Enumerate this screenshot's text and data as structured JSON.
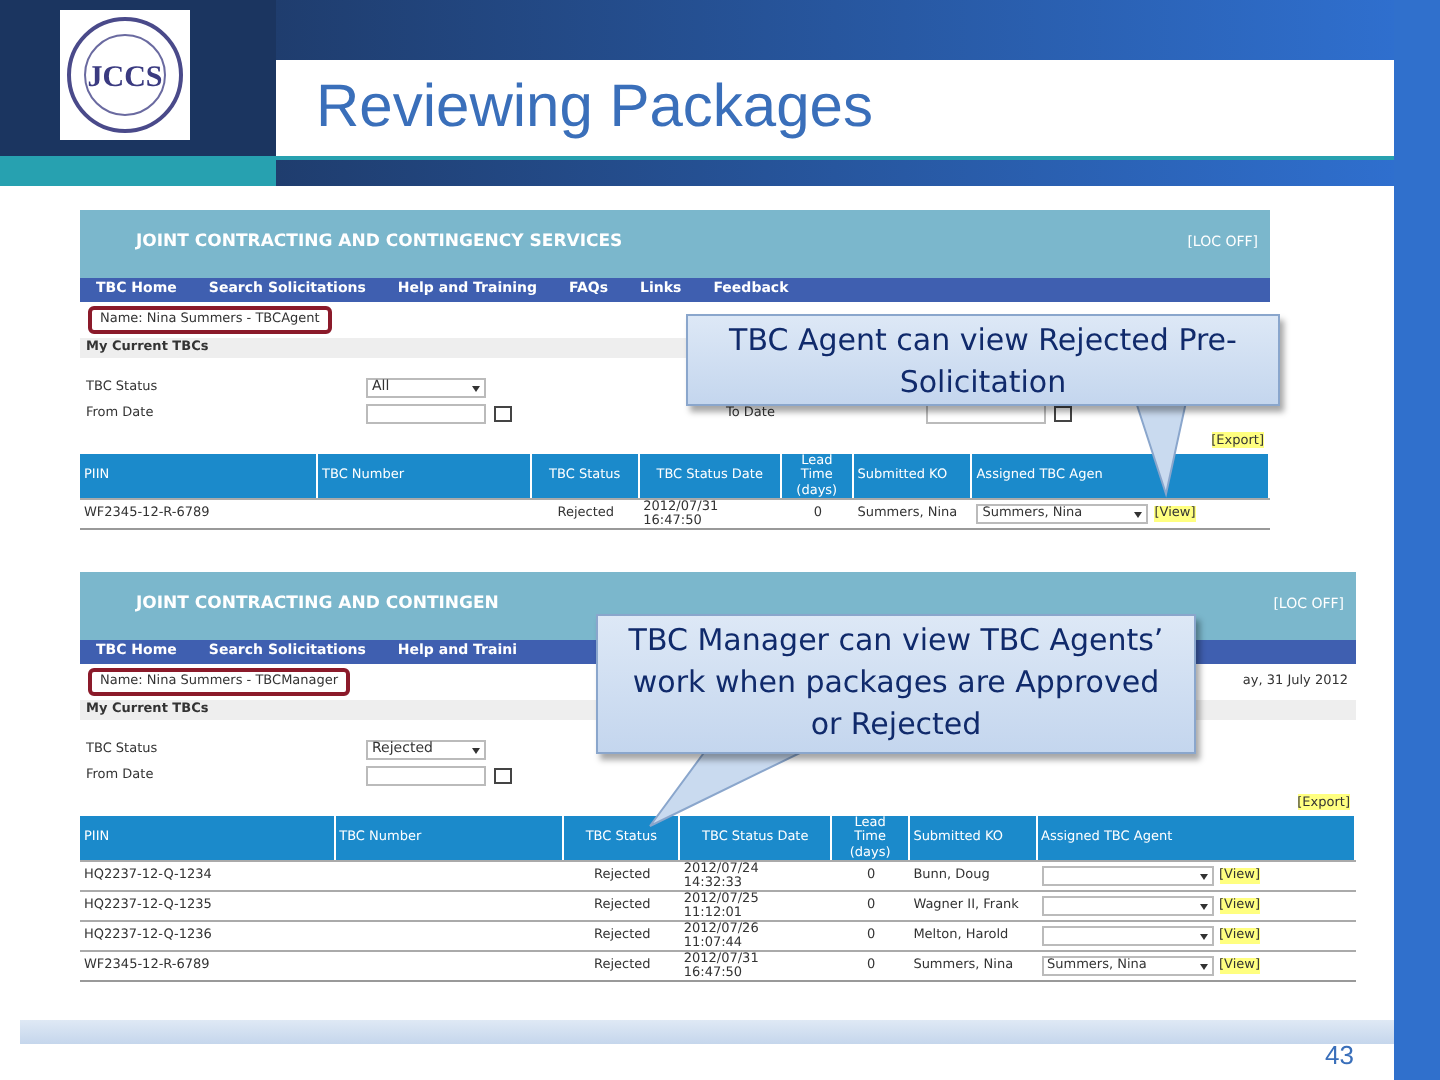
{
  "slide": {
    "logo_text": "JCCS",
    "title": "Reviewing Packages",
    "page_number": "43"
  },
  "screenshots": [
    {
      "banner": "JOINT CONTRACTING AND CONTINGENCY SERVICES",
      "top_link": "[LOC OFF]",
      "nav": [
        "TBC Home",
        "Search Solicitations",
        "Help and Training",
        "FAQs",
        "Links",
        "Feedback"
      ],
      "user": "Name: Nina Summers - TBCAgent",
      "user_highlighted": true,
      "section": "My Current TBCs",
      "filter_rows": [
        [
          {
            "label": "TBC Status",
            "kind": "select",
            "value": "All"
          }
        ],
        [
          {
            "label": "From Date",
            "kind": "date"
          },
          {
            "label": "To Date",
            "kind": "date"
          }
        ]
      ],
      "export": "[Export]",
      "columns": [
        "PIIN",
        "TBC Number",
        "TBC Status",
        "TBC Status Date",
        "Lead Time (days)",
        "Submitted KO",
        "Assigned TBC Agen"
      ],
      "rows": [
        {
          "piin": "WF2345-12-R-6789",
          "status": "Rejected",
          "status_date": "2012/07/31 16:47:50",
          "lead_time": "0",
          "submitted_ko": "Summers, Nina",
          "agent": "Summers, Nina",
          "action": "[View]"
        }
      ]
    },
    {
      "banner": "JOINT CONTRACTING AND CONTINGEN",
      "top_link": "[LOC OFF]",
      "nav": [
        "TBC Home",
        "Search Solicitations",
        "Help and Traini"
      ],
      "user": "Name: Nina Summers - TBCManager",
      "user_highlighted": true,
      "date": "ay, 31 July 2012",
      "section": "My Current TBCs",
      "filter_rows": [
        [
          {
            "label": "TBC Status",
            "kind": "select",
            "value": "Rejected"
          }
        ],
        [
          {
            "label": "From Date",
            "kind": "date"
          }
        ]
      ],
      "export": "[Export]",
      "columns": [
        "PIIN",
        "TBC Number",
        "TBC Status",
        "TBC Status Date",
        "Lead Time (days)",
        "Submitted KO",
        "Assigned TBC Agent"
      ],
      "rows": [
        {
          "piin": "HQ2237-12-Q-1234",
          "status": "Rejected",
          "status_date": "2012/07/24 14:32:33",
          "lead_time": "0",
          "submitted_ko": "Bunn, Doug",
          "action": "[View]"
        },
        {
          "piin": "HQ2237-12-Q-1235",
          "status": "Rejected",
          "status_date": "2012/07/25 11:12:01",
          "lead_time": "0",
          "submitted_ko": "Wagner II, Frank",
          "action": "[View]"
        },
        {
          "piin": "HQ2237-12-Q-1236",
          "status": "Rejected",
          "status_date": "2012/07/26 11:07:44",
          "lead_time": "0",
          "submitted_ko": "Melton, Harold",
          "action": "[View]"
        },
        {
          "piin": "WF2345-12-R-6789",
          "status": "Rejected",
          "status_date": "2012/07/31 16:47:50",
          "lead_time": "0",
          "submitted_ko": "Summers, Nina",
          "agent": "Summers, Nina",
          "action": "[View]"
        }
      ]
    }
  ],
  "callouts": [
    {
      "text": "TBC Agent can view Rejected Pre-Solicitation"
    },
    {
      "text": "TBC Manager can view TBC Agents’ work when packages are Approved or Rejected"
    }
  ]
}
